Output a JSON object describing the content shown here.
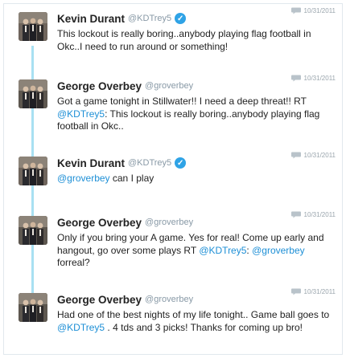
{
  "tweets": [
    {
      "name": "Kevin Durant",
      "handle": "@KDTrey5",
      "verified": true,
      "date": "10/31/2011",
      "segments": [
        {
          "t": "This lockout is really boring..anybody playing flag football in Okc..I need to run around or something!"
        }
      ]
    },
    {
      "name": "George Overbey",
      "handle": "@groverbey",
      "verified": false,
      "date": "10/31/2011",
      "segments": [
        {
          "t": "Got a game tonight in Stillwater!! I need a deep threat!! RT "
        },
        {
          "t": "@KDTrey5",
          "m": true
        },
        {
          "t": ": This lockout is really boring..anybody playing flag football in Okc.."
        }
      ]
    },
    {
      "name": "Kevin Durant",
      "handle": "@KDTrey5",
      "verified": true,
      "date": "10/31/2011",
      "segments": [
        {
          "t": "@groverbey",
          "m": true
        },
        {
          "t": " can I play"
        }
      ]
    },
    {
      "name": "George Overbey",
      "handle": "@groverbey",
      "verified": false,
      "date": "10/31/2011",
      "segments": [
        {
          "t": "Only if you bring your A game. Yes for real! Come up early and hangout, go over some plays RT "
        },
        {
          "t": "@KDTrey5",
          "m": true
        },
        {
          "t": ": "
        },
        {
          "t": "@groverbey",
          "m": true
        },
        {
          "t": " forreal?"
        }
      ]
    },
    {
      "name": "George Overbey",
      "handle": "@groverbey",
      "verified": false,
      "date": "10/31/2011",
      "segments": [
        {
          "t": "Had one of the best nights of my life tonight.. Game ball goes to "
        },
        {
          "t": "@KDTrey5",
          "m": true
        },
        {
          "t": " . 4 tds and 3 picks! Thanks for coming up bro!"
        }
      ]
    }
  ],
  "icons": {
    "reply": "speech-bubble-icon",
    "verified": "verified-check-icon"
  },
  "colors": {
    "mention": "#1d8fd6",
    "thread_line": "#a8e0f2",
    "verified": "#2fa3e6",
    "handle": "#8899a6"
  }
}
